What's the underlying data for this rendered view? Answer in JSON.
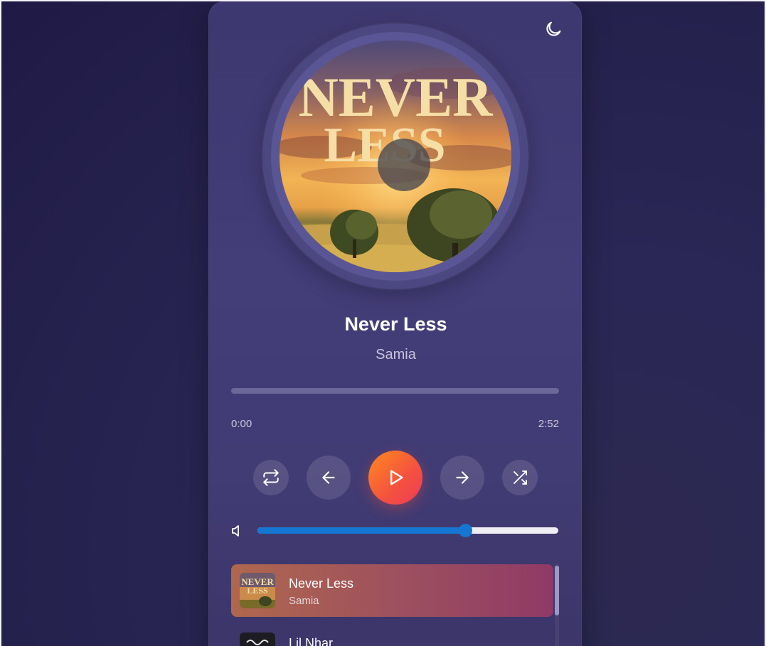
{
  "theme_toggle": {
    "icon": "moon-icon"
  },
  "now_playing": {
    "title": "Never Less",
    "artist": "Samia",
    "album_art_text_line1": "NEVER",
    "album_art_text_line2": "LESS",
    "progress": 0,
    "current_time": "0:00",
    "duration": "2:52"
  },
  "controls": {
    "repeat_icon": "repeat-icon",
    "prev_icon": "arrow-left-icon",
    "play_icon": "play-icon",
    "next_icon": "arrow-right-icon",
    "shuffle_icon": "shuffle-icon"
  },
  "volume": {
    "icon": "volume-icon",
    "level": 0.69
  },
  "playlist": [
    {
      "title": "Never Less",
      "artist": "Samia",
      "art_text1": "NEVER",
      "art_text2": "LESS",
      "active": true
    },
    {
      "title": "Lil Nhar",
      "artist": "",
      "active": false
    }
  ],
  "colors": {
    "accent_start": "#ff8a1f",
    "accent_end": "#ee3b58",
    "volume": "#1677d2",
    "card_bg": "#433d78"
  }
}
